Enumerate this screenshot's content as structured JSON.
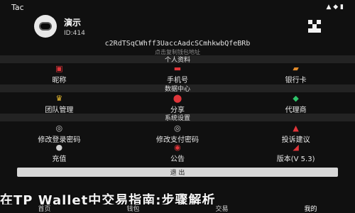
{
  "status": {
    "time": "Tac",
    "icons": "▲ ◆ ▮"
  },
  "profile": {
    "name": "演示",
    "id": "ID:414"
  },
  "address": {
    "value": "c2RdTSqCWhff3UaccAadcSCmhkwbQfeBRb",
    "hint": "点击复制钱包地址"
  },
  "sections": [
    {
      "title": "个人资料",
      "items": [
        {
          "label": "昵称",
          "icon": "user-badge-icon",
          "glyph": "▣",
          "color": "#e0353a"
        },
        {
          "label": "手机号",
          "icon": "phone-icon",
          "glyph": "▬",
          "color": "#e0353a"
        },
        {
          "label": "银行卡",
          "icon": "bank-card-icon",
          "glyph": "▰",
          "color": "#e08a2a"
        }
      ]
    },
    {
      "title": "数据中心",
      "items": [
        {
          "label": "团队管理",
          "icon": "crown-icon",
          "glyph": "♛",
          "color": "#f1c232"
        },
        {
          "label": "分享",
          "icon": "share-icon",
          "glyph": "⬤",
          "color": "#e0353a"
        },
        {
          "label": "代理商",
          "icon": "agent-icon",
          "glyph": "◆",
          "color": "#2ec46a"
        }
      ]
    },
    {
      "title": "系统设置",
      "items": [
        {
          "label": "修改登录密码",
          "icon": "lock-icon",
          "glyph": "◎",
          "color": "#cfcfcf"
        },
        {
          "label": "修改支付密码",
          "icon": "key-icon",
          "glyph": "◎",
          "color": "#cfcfcf"
        },
        {
          "label": "投诉建议",
          "icon": "warning-icon",
          "glyph": "▲",
          "color": "#e0353a"
        }
      ]
    },
    {
      "title": "",
      "items": [
        {
          "label": "充值",
          "icon": "recharge-icon",
          "glyph": "●",
          "color": "#cfcfcf"
        },
        {
          "label": "公告",
          "icon": "notice-icon",
          "glyph": "◉",
          "color": "#e0353a"
        },
        {
          "label": "版本(V 5.3)",
          "icon": "version-icon",
          "glyph": "◢",
          "color": "#e0353a"
        }
      ]
    }
  ],
  "logout_label": "退 出",
  "caption": "在TP Wallet中交易指南:步骤解析",
  "tabs": [
    "首页",
    "钱包",
    "交易",
    "我的"
  ]
}
